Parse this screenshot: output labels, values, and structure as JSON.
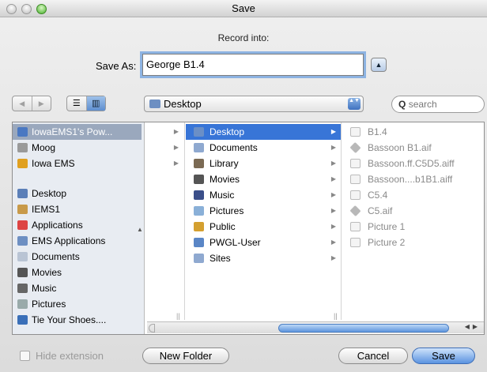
{
  "window": {
    "title": "Save"
  },
  "dialog": {
    "record_into": "Record into:",
    "save_as_label": "Save As:",
    "save_as_value": "George B1.4",
    "disclosure_glyph": "▲"
  },
  "toolbar": {
    "back_glyph": "◀",
    "forward_glyph": "▶",
    "list_view_glyph": "☰",
    "column_view_glyph": "▥",
    "location": "Desktop",
    "location_arrows": "▲▼",
    "search_placeholder": "search",
    "search_glyph": "Q"
  },
  "sidebar": {
    "items": [
      {
        "label": "IowaEMS1's Pow...",
        "icon": "computer-icon",
        "selected": true
      },
      {
        "label": "Moog",
        "icon": "disk-icon"
      },
      {
        "label": "Iowa EMS",
        "icon": "drive-icon"
      },
      {
        "label": "Desktop",
        "icon": "desktop-icon"
      },
      {
        "label": "IEMS1",
        "icon": "home-icon"
      },
      {
        "label": "Applications",
        "icon": "applications-icon"
      },
      {
        "label": "EMS Applications",
        "icon": "folder-icon"
      },
      {
        "label": "Documents",
        "icon": "documents-icon"
      },
      {
        "label": "Movies",
        "icon": "movies-icon"
      },
      {
        "label": "Music",
        "icon": "music-icon"
      },
      {
        "label": "Pictures",
        "icon": "pictures-icon"
      },
      {
        "label": "Tie Your Shoes....",
        "icon": "file-icon"
      }
    ]
  },
  "columns": {
    "col1_arrows": [
      "▶",
      "▶",
      "▶"
    ],
    "col2": [
      {
        "label": "Desktop",
        "selected": true
      },
      {
        "label": "Documents"
      },
      {
        "label": "Library"
      },
      {
        "label": "Movies"
      },
      {
        "label": "Music"
      },
      {
        "label": "Pictures"
      },
      {
        "label": "Public"
      },
      {
        "label": "PWGL-User"
      },
      {
        "label": "Sites"
      }
    ],
    "col3": [
      {
        "label": "B1.4",
        "icon": "document-icon"
      },
      {
        "label": "Bassoon B1.aif",
        "icon": "aiff-icon"
      },
      {
        "label": "Bassoon.ff.C5D5.aiff",
        "icon": "audio-icon"
      },
      {
        "label": "Bassoon....b1B1.aiff",
        "icon": "audio-icon"
      },
      {
        "label": "C5.4",
        "icon": "document-icon"
      },
      {
        "label": "C5.aif",
        "icon": "aiff-icon"
      },
      {
        "label": "Picture 1",
        "icon": "picture-icon"
      },
      {
        "label": "Picture 2",
        "icon": "picture-icon"
      }
    ]
  },
  "footer": {
    "hide_extension": "Hide extension",
    "new_folder": "New Folder",
    "cancel": "Cancel",
    "save": "Save"
  },
  "colors": {
    "selection": "#3875d7",
    "sidebar_selection": "#9aa8bd",
    "focus_ring": "#8db3e2"
  }
}
